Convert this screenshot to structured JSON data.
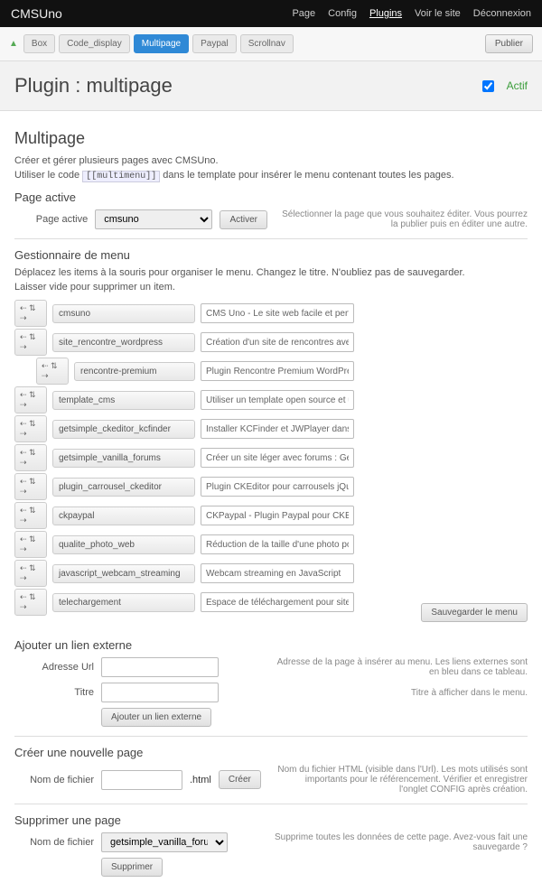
{
  "top": {
    "brand": "CMSUno",
    "nav": [
      "Page",
      "Config",
      "Plugins",
      "Voir le site",
      "Déconnexion"
    ],
    "active": 2
  },
  "tabs": {
    "items": [
      "Box",
      "Code_display",
      "Multipage",
      "Paypal",
      "Scrollnav"
    ],
    "active": 2,
    "publish": "Publier"
  },
  "header": {
    "title": "Plugin : multipage",
    "state": "Actif"
  },
  "intro": {
    "h2": "Multipage",
    "l1": "Créer et gérer plusieurs pages avec CMSUno.",
    "l2a": "Utiliser le code ",
    "code": "[[multimenu]]",
    "l2b": " dans le template pour insérer le menu contenant toutes les pages."
  },
  "active": {
    "h3": "Page active",
    "label": "Page active",
    "value": "cmsuno",
    "btn": "Activer",
    "hint": "Sélectionner la page que vous souhaitez éditer. Vous pourrez la publier puis en éditer une autre."
  },
  "menu": {
    "h3": "Gestionnaire de menu",
    "help1": "Déplacez les items à la souris pour organiser le menu. Changez le titre. N'oubliez pas de sauvegarder.",
    "help2": "Laisser vide pour supprimer un item.",
    "items": [
      {
        "slug": "cmsuno",
        "desc": "CMS Uno - Le site web facile et perfo"
      },
      {
        "slug": "site_rencontre_wordpress",
        "desc": "Création d'un site de rencontres avec"
      },
      {
        "slug": "rencontre-premium",
        "desc": "Plugin Rencontre Premium WordPress",
        "indent": true
      },
      {
        "slug": "template_cms",
        "desc": "Utiliser un template open source et u"
      },
      {
        "slug": "getsimple_ckeditor_kcfinder",
        "desc": "Installer KCFinder et JWPlayer dans G"
      },
      {
        "slug": "getsimple_vanilla_forums",
        "desc": "Créer un site léger avec forums : Get"
      },
      {
        "slug": "plugin_carrousel_ckeditor",
        "desc": "Plugin CKEditor pour carrousels jQuer"
      },
      {
        "slug": "ckpaypal",
        "desc": "CKPaypal - Plugin Paypal pour CKEdit"
      },
      {
        "slug": "qualite_photo_web",
        "desc": "Réduction de la taille d'une photo po"
      },
      {
        "slug": "javascript_webcam_streaming",
        "desc": "Webcam streaming en JavaScript"
      },
      {
        "slug": "telechargement",
        "desc": "Espace de téléchargement pour site"
      }
    ],
    "save": "Sauvegarder le menu"
  },
  "ext": {
    "h3": "Ajouter un lien externe",
    "url_label": "Adresse Url",
    "url_hint": "Adresse de la page à insérer au menu. Les liens externes sont en bleu dans ce tableau.",
    "title_label": "Titre",
    "title_hint": "Titre à afficher dans le menu.",
    "btn": "Ajouter un lien externe"
  },
  "create": {
    "h3": "Créer une nouvelle page",
    "label": "Nom de fichier",
    "suffix": ".html",
    "btn": "Créer",
    "hint": "Nom du fichier HTML (visible dans l'Url). Les mots utilisés sont importants pour le référencement. Vérifier et enregistrer l'onglet CONFIG après création."
  },
  "del": {
    "h3": "Supprimer une page",
    "label": "Nom de fichier",
    "value": "getsimple_vanilla_forums",
    "hint": "Supprime toutes les données de cette page. Avez-vous fait une sauvegarde ?",
    "btn": "Supprimer"
  }
}
